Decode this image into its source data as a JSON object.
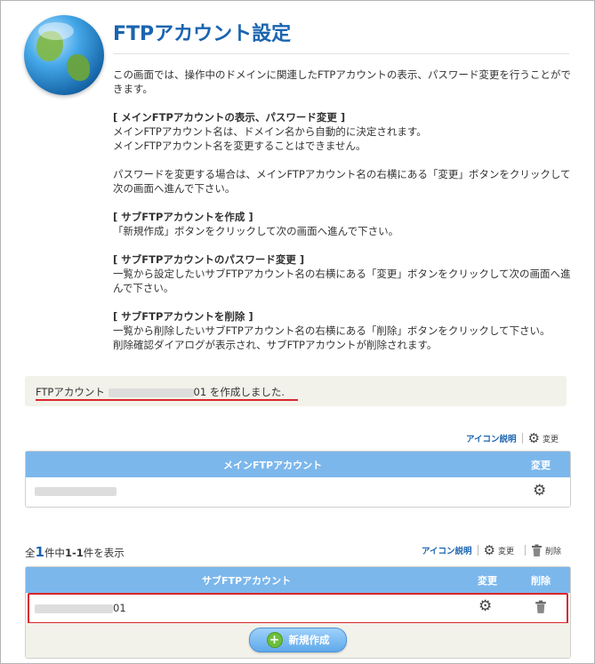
{
  "title": "FTPアカウント設定",
  "intro": "この画面では、操作中のドメインに関連したFTPアカウントの表示、パスワード変更を行うことができます。",
  "sections": [
    {
      "heading": "[ メインFTPアカウントの表示、パスワード変更 ]",
      "lines": [
        "メインFTPアカウント名は、ドメイン名から自動的に決定されます。",
        "メインFTPアカウント名を変更することはできません。"
      ]
    },
    {
      "heading": "",
      "lines": [
        "パスワードを変更する場合は、メインFTPアカウント名の右横にある「変更」ボタンをクリックして",
        "次の画面へ進んで下さい。"
      ]
    },
    {
      "heading": "[ サブFTPアカウントを作成 ]",
      "lines": [
        "「新規作成」ボタンをクリックして次の画面へ進んで下さい。"
      ]
    },
    {
      "heading": "[ サブFTPアカウントのパスワード変更 ]",
      "lines": [
        "一覧から設定したいサブFTPアカウント名の右横にある「変更」ボタンをクリックして次の画面へ進んで下さい。"
      ]
    },
    {
      "heading": "[ サブFTPアカウントを削除 ]",
      "lines": [
        "一覧から削除したいサブFTPアカウント名の右横にある「削除」ボタンをクリックして下さい。",
        "削除確認ダイアログが表示され、サブFTPアカウントが削除されます。"
      ]
    }
  ],
  "notice": {
    "prefix": "FTPアカウント ",
    "masked_account": "■■■■■■■■■■",
    "suffix": "01 を作成しました."
  },
  "main_iconbar": {
    "legend_link": "アイコン説明",
    "change": "変更"
  },
  "main_table": {
    "col_name": "メインFTPアカウント",
    "col_change": "変更",
    "row_masked": "■■■■■■■■■■"
  },
  "count": {
    "pre": "全",
    "total": "1",
    "mid": "件中",
    "range": "1-1",
    "post": "件を表示"
  },
  "sub_iconbar": {
    "legend_link": "アイコン説明",
    "change": "変更",
    "delete": "削除"
  },
  "sub_table": {
    "col_name": "サブFTPアカウント",
    "col_change": "変更",
    "col_delete": "削除",
    "row_masked": "■■■■■■■■■■",
    "row_suffix": "01"
  },
  "new_button": "新規作成",
  "icons": {
    "globe": "globe-icon",
    "gear": "gear-icon",
    "trash": "trash-icon",
    "plus": "plus-circle-icon"
  },
  "colors": {
    "title": "#1a64b0",
    "table_header": "#7cb7ec",
    "highlight": "#d9262e",
    "notice_bg": "#f2f2ea"
  }
}
